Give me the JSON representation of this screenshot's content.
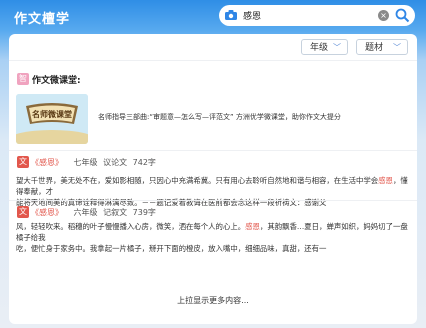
{
  "app": {
    "title": "作文檀学"
  },
  "search": {
    "value": "感恩"
  },
  "filters": {
    "grade": "年级",
    "topic": "题材"
  },
  "lesson": {
    "badge": "智",
    "title": "作文微课堂:",
    "thumb_text": "名师微课堂",
    "description": "名师指导三部曲:“审题意—怎么写—评范文” 方洲优学微课堂，助你作文大提分"
  },
  "essays": [
    {
      "badge": "文",
      "title": "《感恩》",
      "grade": "七年级",
      "genre": "议论文",
      "count": "742字",
      "lines": [
        [
          "望大千世界，美无处不在，爱如影相随，只因心中充满希冀。只有用心去聆听自然地和谐与相容，在生活中学会",
          "感恩",
          "，懂得奉献，才"
        ],
        [
          "能将天地间美的真谛诠释得淋漓尽致。－－题记爱着教诲在医前都会念这样一段祈祷文：感谢父"
        ]
      ]
    },
    {
      "badge": "文",
      "title": "《感恩》",
      "grade": "六年级",
      "genre": "记叙文",
      "count": "739字",
      "lines": [
        [
          "风，轻轻吹来。稻穗的叶子慢慢播入心房，微笑，洒在每个人的心上。",
          "感恩",
          "，其韵飘香…夏日，蝉声如织，妈妈切了一盘橘子给我"
        ],
        [
          "吃，便忙身于家务中。我拿起一片橘子，掰开下面的橙皮，放入嘴中，细细品味，真甜，还有一"
        ]
      ]
    }
  ],
  "more_text": "上拉显示更多内容..."
}
